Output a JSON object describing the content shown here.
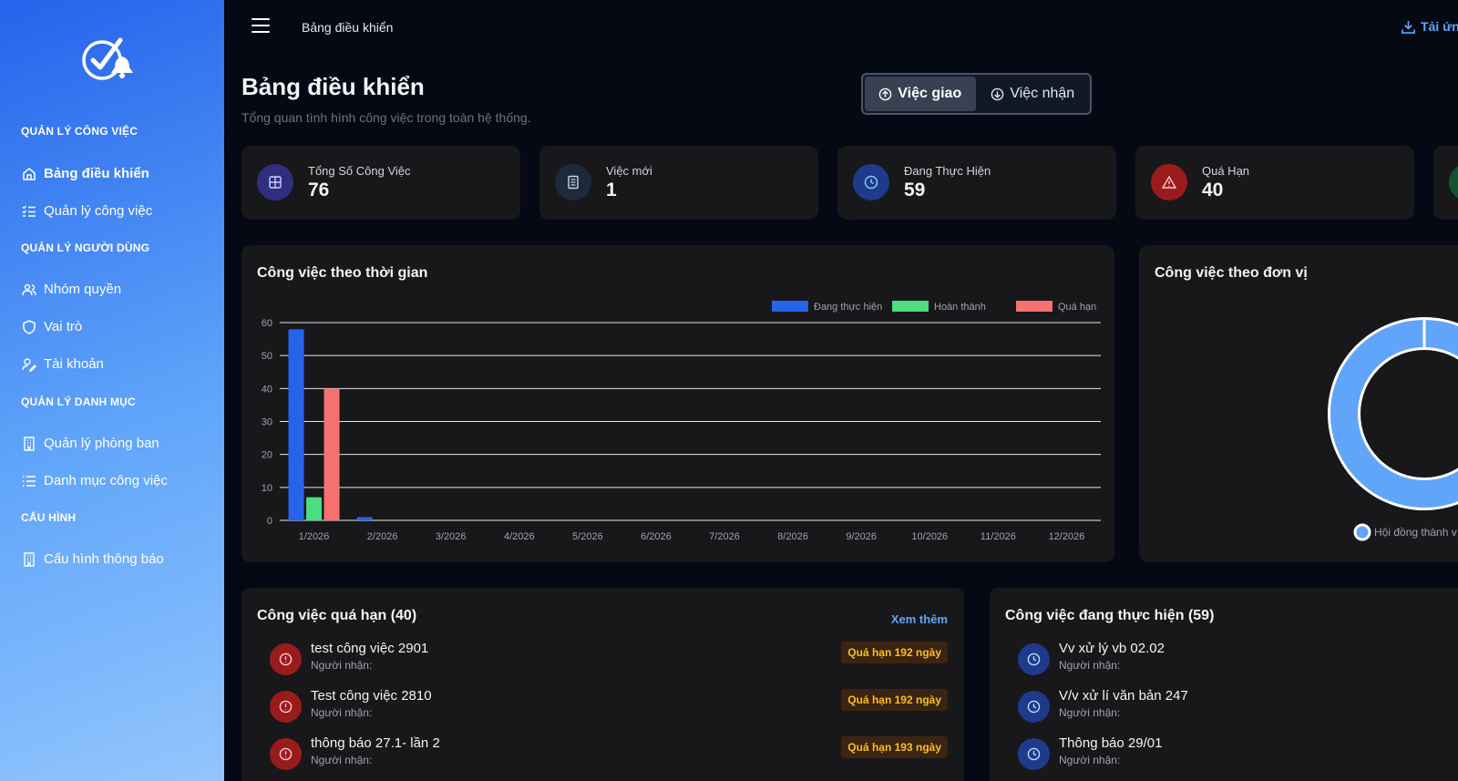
{
  "sidebar": {
    "sections": [
      {
        "title": "QUẢN LÝ CÔNG VIỆC",
        "items": [
          {
            "label": "Bảng điều khiển",
            "icon": "home-icon"
          },
          {
            "label": "Quản lý công việc",
            "icon": "list-check-icon"
          }
        ]
      },
      {
        "title": "QUẢN LÝ NGƯỜI DÙNG",
        "items": [
          {
            "label": "Nhóm quyền",
            "icon": "users-icon"
          },
          {
            "label": "Vai trò",
            "icon": "shield-icon"
          },
          {
            "label": "Tài khoản",
            "icon": "user-edit-icon"
          }
        ]
      },
      {
        "title": "QUẢN LÝ DANH MỤC",
        "items": [
          {
            "label": "Quản lý phòng ban",
            "icon": "building-icon"
          },
          {
            "label": "Danh mục công việc",
            "icon": "list-icon"
          }
        ]
      },
      {
        "title": "CẤU HÌNH",
        "items": [
          {
            "label": "Cấu hình thông báo",
            "icon": "building-icon"
          }
        ]
      }
    ]
  },
  "topbar": {
    "title": "Bảng điều khiển",
    "download_label": "Tải ứn"
  },
  "header": {
    "title": "Bảng điều khiển",
    "subtitle": "Tổng quan tình hình công việc trong toàn hệ thống."
  },
  "toggle": {
    "assigned": "Việc giao",
    "received": "Việc nhận"
  },
  "stats": [
    {
      "label": "Tổng Số Công Việc",
      "value": "76",
      "icon": "grid-icon",
      "color": "#312e81"
    },
    {
      "label": "Việc mới",
      "value": "1",
      "icon": "document-icon",
      "color": "#1e293b"
    },
    {
      "label": "Đang Thực Hiện",
      "value": "59",
      "icon": "clock-icon",
      "color": "#1e3a8a"
    },
    {
      "label": "Quá Hạn",
      "value": "40",
      "icon": "alert-icon",
      "color": "#991b1b"
    }
  ],
  "colors": {
    "in_progress": "#2563eb",
    "done": "#4ade80",
    "overdue": "#f87171",
    "donut": "#60a5fa"
  },
  "chart_data": [
    {
      "type": "bar",
      "title": "Công việc theo thời gian",
      "categories": [
        "1/2026",
        "2/2026",
        "3/2026",
        "4/2026",
        "5/2026",
        "6/2026",
        "7/2026",
        "8/2026",
        "9/2026",
        "10/2026",
        "11/2026",
        "12/2026"
      ],
      "series": [
        {
          "name": "Đang thực hiện",
          "values": [
            58,
            1,
            0,
            0,
            0,
            0,
            0,
            0,
            0,
            0,
            0,
            0
          ]
        },
        {
          "name": "Hoàn thành",
          "values": [
            7,
            0,
            0,
            0,
            0,
            0,
            0,
            0,
            0,
            0,
            0,
            0
          ]
        },
        {
          "name": "Quá hạn",
          "values": [
            40,
            0,
            0,
            0,
            0,
            0,
            0,
            0,
            0,
            0,
            0,
            0
          ]
        }
      ],
      "yticks": [
        "0",
        "10",
        "20",
        "30",
        "40",
        "50",
        "60"
      ],
      "ylim": [
        0,
        60
      ],
      "grid": true,
      "legend": "top-right"
    },
    {
      "type": "pie",
      "title": "Công việc theo đơn vị",
      "categories": [
        "Hội đồng thành v"
      ],
      "values": [
        76
      ],
      "legend": "bottom"
    }
  ],
  "overdue_list": {
    "title": "Công việc quá hạn (40)",
    "see_more": "Xem thêm",
    "items": [
      {
        "name": "test công việc 2901",
        "sub": "Người nhận:",
        "badge": "Quá hạn 192 ngày"
      },
      {
        "name": "Test công việc 2810",
        "sub": "Người nhận:",
        "badge": "Quá hạn 192 ngày"
      },
      {
        "name": "thông báo 27.1- lần 2",
        "sub": "Người nhận:",
        "badge": "Quá hạn 193 ngày"
      }
    ]
  },
  "progress_list": {
    "title": "Công việc đang thực hiện (59)",
    "items": [
      {
        "name": "Vv xử lý vb 02.02",
        "sub": "Người nhận:"
      },
      {
        "name": "V/v xử lí văn bản 247",
        "sub": "Người nhận:"
      },
      {
        "name": "Thông báo 29/01",
        "sub": "Người nhận:"
      }
    ]
  }
}
